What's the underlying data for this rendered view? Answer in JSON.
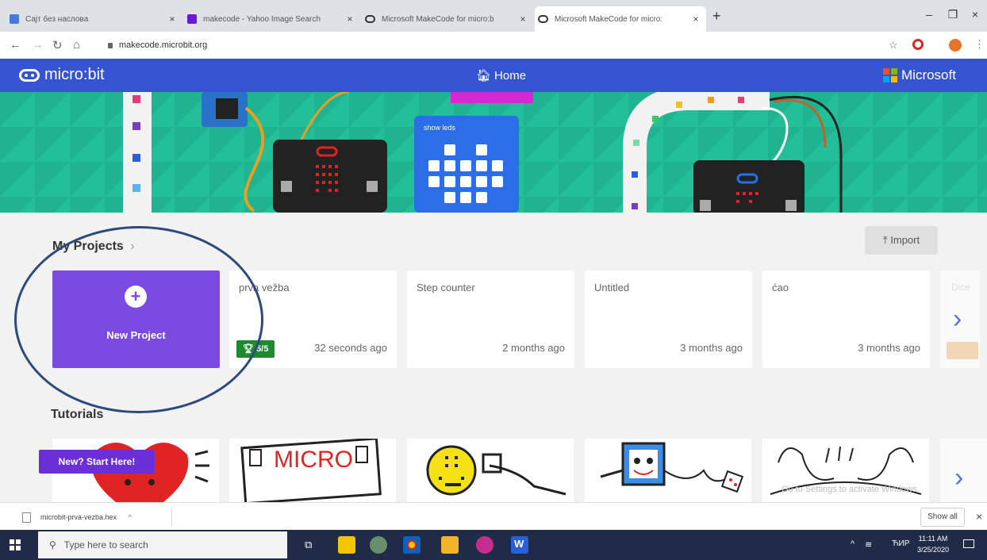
{
  "browser": {
    "tabs": [
      {
        "label": "Сајт без насловa",
        "close": "×"
      },
      {
        "label": "makecode - Yahoo Image Search",
        "close": "×"
      },
      {
        "label": "Microsoft MakeCode for micro:b",
        "close": "×"
      },
      {
        "label": "Microsoft MakeCode for micro:",
        "close": "×"
      }
    ],
    "new_tab": "+",
    "window": {
      "minimize": "–",
      "maximize": "❐",
      "close": "×"
    },
    "address": "makecode.microbit.org"
  },
  "header": {
    "logo": "micro:bit",
    "home": "Home",
    "brand": "Microsoft"
  },
  "hero": {
    "block_label": "show leds"
  },
  "projects": {
    "title": "My Projects",
    "title_chevron": "›",
    "import_label": "Import",
    "new_project_label": "New Project",
    "items": [
      {
        "name": "prva vežba",
        "time": "32 seconds ago",
        "badge": "5/5"
      },
      {
        "name": "Step counter",
        "time": "2 months ago"
      },
      {
        "name": "Untitled",
        "time": "3 months ago"
      },
      {
        "name": "ćao",
        "time": "3 months ago"
      }
    ],
    "partial_label": "Dice",
    "next_arrow": "›"
  },
  "tutorials": {
    "title": "Tutorials",
    "start_badge": "New? Start Here!",
    "micro_text": "MICRO",
    "next_arrow": "›"
  },
  "download": {
    "file": "microbit-prva-vezba.hex",
    "show_all": "Show all",
    "close": "×"
  },
  "watermark": "Go to Settings to activate Windows.",
  "taskbar": {
    "search_placeholder": "Type here to search",
    "lang": "ЋИР",
    "time": "11:11 AM",
    "date": "3/25/2020"
  },
  "colors": {
    "header_blue": "#3454d1",
    "new_project_purple": "#7b4ae0",
    "hero_green": "#1fb38f",
    "badge_green": "#1e8a2e"
  }
}
